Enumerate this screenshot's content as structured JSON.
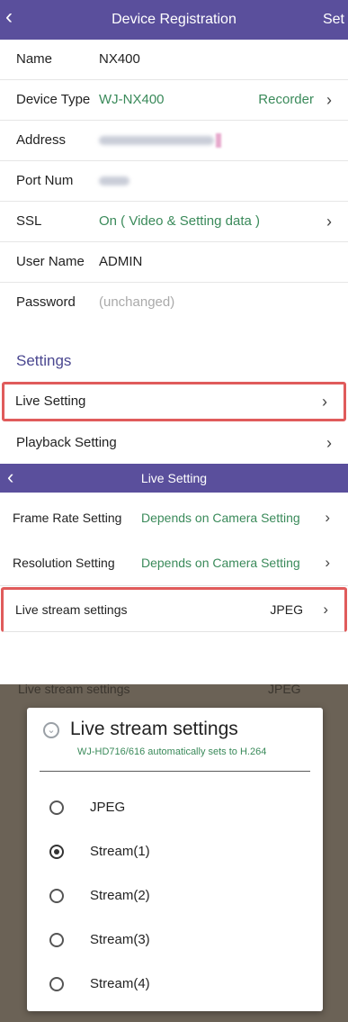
{
  "header": {
    "back_icon": "back-chevron-icon",
    "title": "Device Registration",
    "action": "Set"
  },
  "registration": {
    "name": {
      "label": "Name",
      "value": "NX400"
    },
    "device_type": {
      "label": "Device Type",
      "value": "WJ-NX400",
      "right": "Recorder"
    },
    "address": {
      "label": "Address"
    },
    "port": {
      "label": "Port Num"
    },
    "ssl": {
      "label": "SSL",
      "value": "On ( Video & Setting data )"
    },
    "user": {
      "label": "User Name",
      "value": "ADMIN"
    },
    "password": {
      "label": "Password",
      "value": "(unchanged)"
    }
  },
  "settings": {
    "heading": "Settings",
    "items": [
      {
        "label": "Live Setting"
      },
      {
        "label": "Playback Setting"
      }
    ]
  },
  "live": {
    "title": "Live Setting",
    "rows": [
      {
        "label": "Frame Rate Setting",
        "value": "Depends on Camera Setting"
      },
      {
        "label": "Resolution Setting",
        "value": "Depends on Camera Setting"
      },
      {
        "label": "Live stream settings",
        "value": "JPEG"
      }
    ]
  },
  "dialog": {
    "ghost_left": "Live stream settings",
    "ghost_right": "JPEG",
    "title": "Live stream settings",
    "subtitle": "WJ-HD716/616 automatically sets to H.264",
    "options": [
      {
        "label": "JPEG",
        "selected": false
      },
      {
        "label": "Stream(1)",
        "selected": true
      },
      {
        "label": "Stream(2)",
        "selected": false
      },
      {
        "label": "Stream(3)",
        "selected": false
      },
      {
        "label": "Stream(4)",
        "selected": false
      }
    ]
  },
  "colors": {
    "header": "#5a4f9c",
    "accent_green": "#3a8a5a",
    "highlight_red": "#e05b5b"
  }
}
